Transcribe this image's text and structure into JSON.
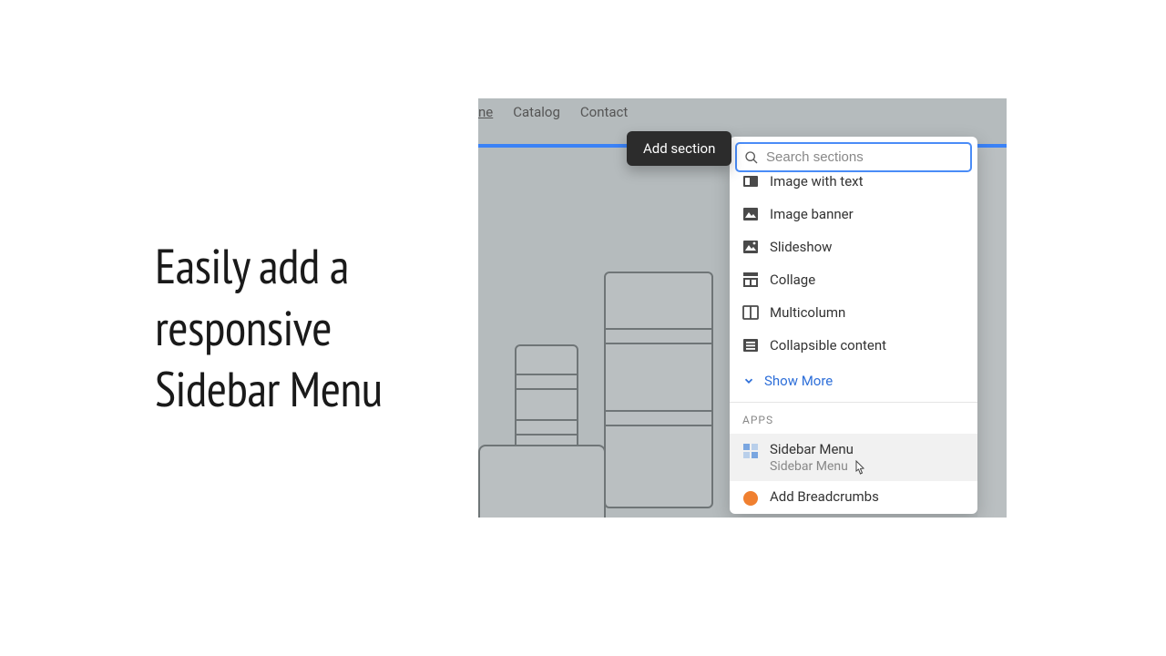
{
  "headline": "Easily add a responsive Sidebar Menu",
  "nav": {
    "home_fragment": "ne",
    "catalog": "Catalog",
    "contact": "Contact"
  },
  "tooltip": {
    "label": "Add section"
  },
  "search": {
    "placeholder": "Search sections"
  },
  "sections": {
    "items": [
      {
        "label": "Image with text",
        "icon": "image-text-icon"
      },
      {
        "label": "Image banner",
        "icon": "image-icon"
      },
      {
        "label": "Slideshow",
        "icon": "slideshow-icon"
      },
      {
        "label": "Collage",
        "icon": "collage-icon"
      },
      {
        "label": "Multicolumn",
        "icon": "columns-icon"
      },
      {
        "label": "Collapsible content",
        "icon": "collapsible-icon"
      }
    ],
    "show_more": "Show More"
  },
  "apps": {
    "header": "APPS",
    "items": [
      {
        "title": "Sidebar Menu",
        "subtitle": "Sidebar Menu",
        "hover": true
      },
      {
        "title": "Add Breadcrumbs",
        "subtitle": "",
        "hover": false
      }
    ]
  }
}
